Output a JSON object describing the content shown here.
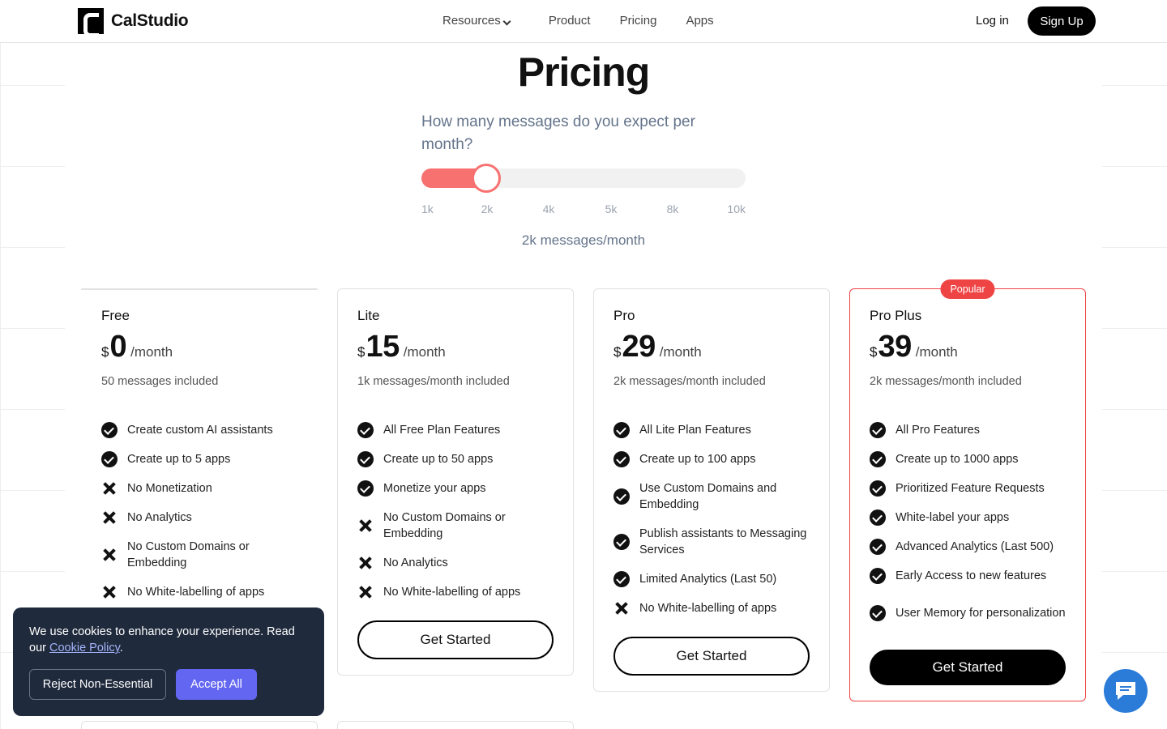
{
  "nav": {
    "brand": "CalStudio",
    "resources_label": "Resources",
    "product_label": "Product",
    "pricing_label": "Pricing",
    "apps_label": "Apps",
    "login_label": "Log in",
    "signup_label": "Sign Up"
  },
  "hero": {
    "title": "Pricing",
    "question": "How many messages do you expect per month?",
    "slider": {
      "ticks": [
        "1k",
        "2k",
        "4k",
        "5k",
        "8k",
        "10k"
      ],
      "selected_index": 1,
      "fill_fraction": 0.2,
      "accent_color": "#f87171"
    },
    "summary": "2k messages/month"
  },
  "plans": [
    {
      "name": "Free",
      "currency": "$",
      "price": "0",
      "period": "/month",
      "included": "50 messages included",
      "features": [
        {
          "icon": "check-icon",
          "text": "Create custom AI assistants"
        },
        {
          "icon": "check-icon",
          "text": "Create up to 5 apps"
        },
        {
          "icon": "x-icon",
          "text": "No Monetization"
        },
        {
          "icon": "x-icon",
          "text": "No Analytics"
        },
        {
          "icon": "x-icon",
          "text": "No Custom Domains or Embedding"
        },
        {
          "icon": "x-icon",
          "text": "No White-labelling of apps"
        }
      ],
      "cta": ""
    },
    {
      "name": "Lite",
      "currency": "$",
      "price": "15",
      "period": "/month",
      "included": "1k messages/month included",
      "features": [
        {
          "icon": "check-icon",
          "text": "All Free Plan Features"
        },
        {
          "icon": "check-icon",
          "text": "Create up to 50 apps"
        },
        {
          "icon": "check-icon",
          "text": "Monetize your apps"
        },
        {
          "icon": "x-icon",
          "text": "No Custom Domains or Embedding"
        },
        {
          "icon": "x-icon",
          "text": "No Analytics"
        },
        {
          "icon": "x-icon",
          "text": "No White-labelling of apps"
        }
      ],
      "cta": "Get Started"
    },
    {
      "name": "Pro",
      "currency": "$",
      "price": "29",
      "period": "/month",
      "included": "2k messages/month included",
      "features": [
        {
          "icon": "check-icon",
          "text": "All Lite Plan Features"
        },
        {
          "icon": "check-icon",
          "text": "Create up to 100 apps"
        },
        {
          "icon": "check-icon",
          "text": "Use Custom Domains and Embedding"
        },
        {
          "icon": "check-icon",
          "text": "Publish assistants to Messaging Services"
        },
        {
          "icon": "check-icon",
          "text": "Limited Analytics (Last 50)"
        },
        {
          "icon": "x-icon",
          "text": "No White-labelling of apps"
        }
      ],
      "cta": "Get Started"
    },
    {
      "name": "Pro Plus",
      "currency": "$",
      "price": "39",
      "period": "/month",
      "included": "2k messages/month included",
      "badge": "Popular",
      "features": [
        {
          "icon": "check-icon",
          "text": "All Pro Features"
        },
        {
          "icon": "check-icon",
          "text": "Create up to 1000 apps"
        },
        {
          "icon": "check-icon",
          "text": "Prioritized Feature Requests"
        },
        {
          "icon": "check-icon",
          "text": "White-label your apps"
        },
        {
          "icon": "check-icon",
          "text": "Advanced Analytics (Last 500)"
        },
        {
          "icon": "check-icon",
          "text": "Early Access to new features"
        },
        {
          "icon": "check-icon",
          "text": "User Memory for personalization"
        }
      ],
      "cta": "Get Started"
    }
  ],
  "cookie": {
    "text": "We use cookies to enhance your experience. Read our ",
    "link": "Cookie Policy",
    "text_end": ".",
    "reject_label": "Reject Non-Essential",
    "accept_label": "Accept All"
  },
  "colors": {
    "accent": "#f87171",
    "popular": "#ef4444",
    "cookie_bg": "#1f2a3c",
    "accept": "#6366f1",
    "chat": "#2b7bd9"
  }
}
